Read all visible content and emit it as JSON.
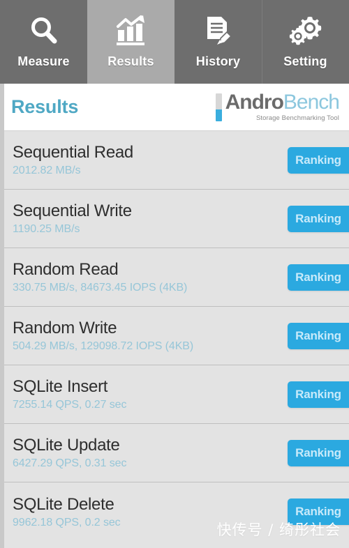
{
  "nav": {
    "tabs": [
      {
        "label": "Measure",
        "icon": "magnifier-icon",
        "active": false
      },
      {
        "label": "Results",
        "icon": "bar-chart-trend-icon",
        "active": true
      },
      {
        "label": "History",
        "icon": "document-pencil-icon",
        "active": false
      },
      {
        "label": "Setting",
        "icon": "gears-icon",
        "active": false
      }
    ]
  },
  "header": {
    "title": "Results",
    "brand_primary": "Andro",
    "brand_secondary": "Bench",
    "tagline": "Storage Benchmarking Tool"
  },
  "results": {
    "ranking_label": "Ranking",
    "rows": [
      {
        "title": "Sequential Read",
        "value": "2012.82 MB/s"
      },
      {
        "title": "Sequential Write",
        "value": "1190.25 MB/s"
      },
      {
        "title": "Random Read",
        "value": "330.75 MB/s, 84673.45 IOPS (4KB)"
      },
      {
        "title": "Random Write",
        "value": "504.29 MB/s, 129098.72 IOPS (4KB)"
      },
      {
        "title": "SQLite Insert",
        "value": "7255.14 QPS, 0.27 sec"
      },
      {
        "title": "SQLite Update",
        "value": "6427.29 QPS, 0.31 sec"
      },
      {
        "title": "SQLite Delete",
        "value": "9962.18 QPS, 0.2 sec"
      }
    ]
  },
  "watermark": {
    "text": "快传号 / 绮彤社会"
  },
  "colors": {
    "nav_bg": "#6e6e6e",
    "nav_active_bg": "#aaaaaa",
    "accent_blue": "#2ba9e0",
    "title_blue": "#4fa8c4",
    "value_blue": "#96c6d8",
    "row_bg": "#e3e3e3"
  }
}
